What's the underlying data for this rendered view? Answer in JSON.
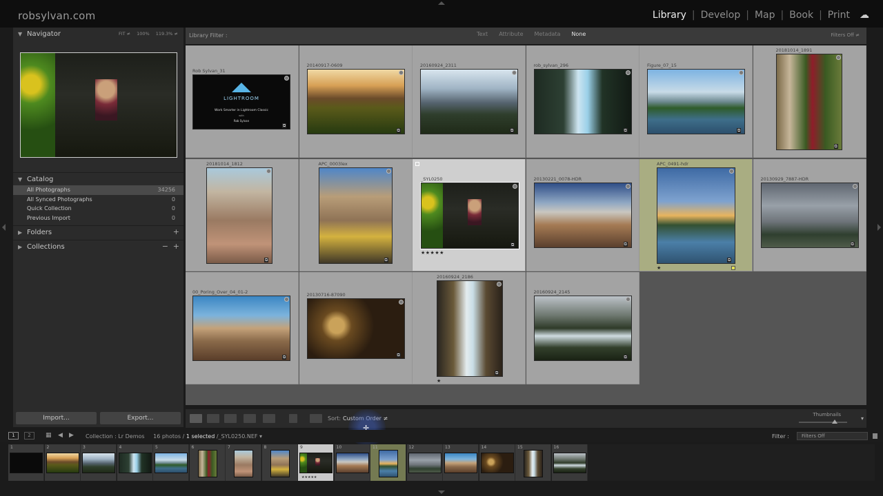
{
  "brand": "robsylvan.com",
  "modules": [
    "Library",
    "Develop",
    "Map",
    "Book",
    "Print"
  ],
  "active_module": "Library",
  "navigator": {
    "title": "Navigator",
    "zoom_options": [
      "FIT ≠",
      "100%",
      "119.3% ≠"
    ]
  },
  "catalog": {
    "title": "Catalog",
    "items": [
      {
        "name": "All Photographs",
        "count": "34256"
      },
      {
        "name": "All Synced Photographs",
        "count": "0"
      },
      {
        "name": "Quick Collection",
        "count": "0"
      },
      {
        "name": "Previous Import",
        "count": "0"
      }
    ]
  },
  "folders_title": "Folders",
  "collections_title": "Collections",
  "import_label": "Import...",
  "export_label": "Export...",
  "filter_bar": {
    "title": "Library Filter :",
    "options": [
      "Text",
      "Attribute",
      "Metadata",
      "None"
    ],
    "active": "None",
    "filters_off": "Filters Off ≠"
  },
  "grid": [
    {
      "name": "Rob Sylvan_31",
      "art": "lightroom",
      "card": {
        "logo": "LIGHTROOM",
        "line1": "Work Smarter in Lightroom Classic",
        "line2": "with",
        "line3": "Rob Sylvan"
      }
    },
    {
      "name": "20140917-0609",
      "art": "sunflower"
    },
    {
      "name": "20160924_2311",
      "art": "mountain"
    },
    {
      "name": "rob_sylvan_296",
      "art": "falls"
    },
    {
      "name": "Figure_07_15",
      "art": "teton"
    },
    {
      "name": "20181014_1891",
      "art": "girl"
    },
    {
      "name": "20181014_1812",
      "art": "rocks"
    },
    {
      "name": "APC_0003lex",
      "art": "bridge"
    },
    {
      "name": "_SYL0250",
      "art": "jeep",
      "selected": true,
      "stars": "★★★★★"
    },
    {
      "name": "20130221_0078-HDR",
      "art": "car"
    },
    {
      "name": "APC_0491-hdr",
      "art": "boats",
      "tinted": true,
      "stars": "★"
    },
    {
      "name": "20130929_7887-HDR",
      "art": "storm"
    },
    {
      "name": "00_Poring_Over_04_01-2",
      "art": "desert"
    },
    {
      "name": "20130716-87090",
      "art": "fly"
    },
    {
      "name": "20160924_2186",
      "art": "waterfall",
      "stars": "★"
    },
    {
      "name": "20160924_2145",
      "art": "cascade"
    }
  ],
  "toolbar": {
    "sort_label": "Sort:",
    "sort_value": "Custom Order ≠",
    "thumbnails_label": "Thumbnails"
  },
  "filmstrip_header": {
    "screen1": "1",
    "screen2": "2",
    "collection": "Collection : Lr Demos",
    "photos_count": "16 photos /",
    "selected": "1 selected",
    "file": "/_SYL0250.NEF ▾",
    "filter_label": "Filter :",
    "filter_value": "Filters Off"
  },
  "filmstrip_numbers": [
    "1",
    "2",
    "3",
    "4",
    "5",
    "6",
    "7",
    "8",
    "9",
    "10",
    "11",
    "12",
    "13",
    "14",
    "15",
    "16"
  ]
}
